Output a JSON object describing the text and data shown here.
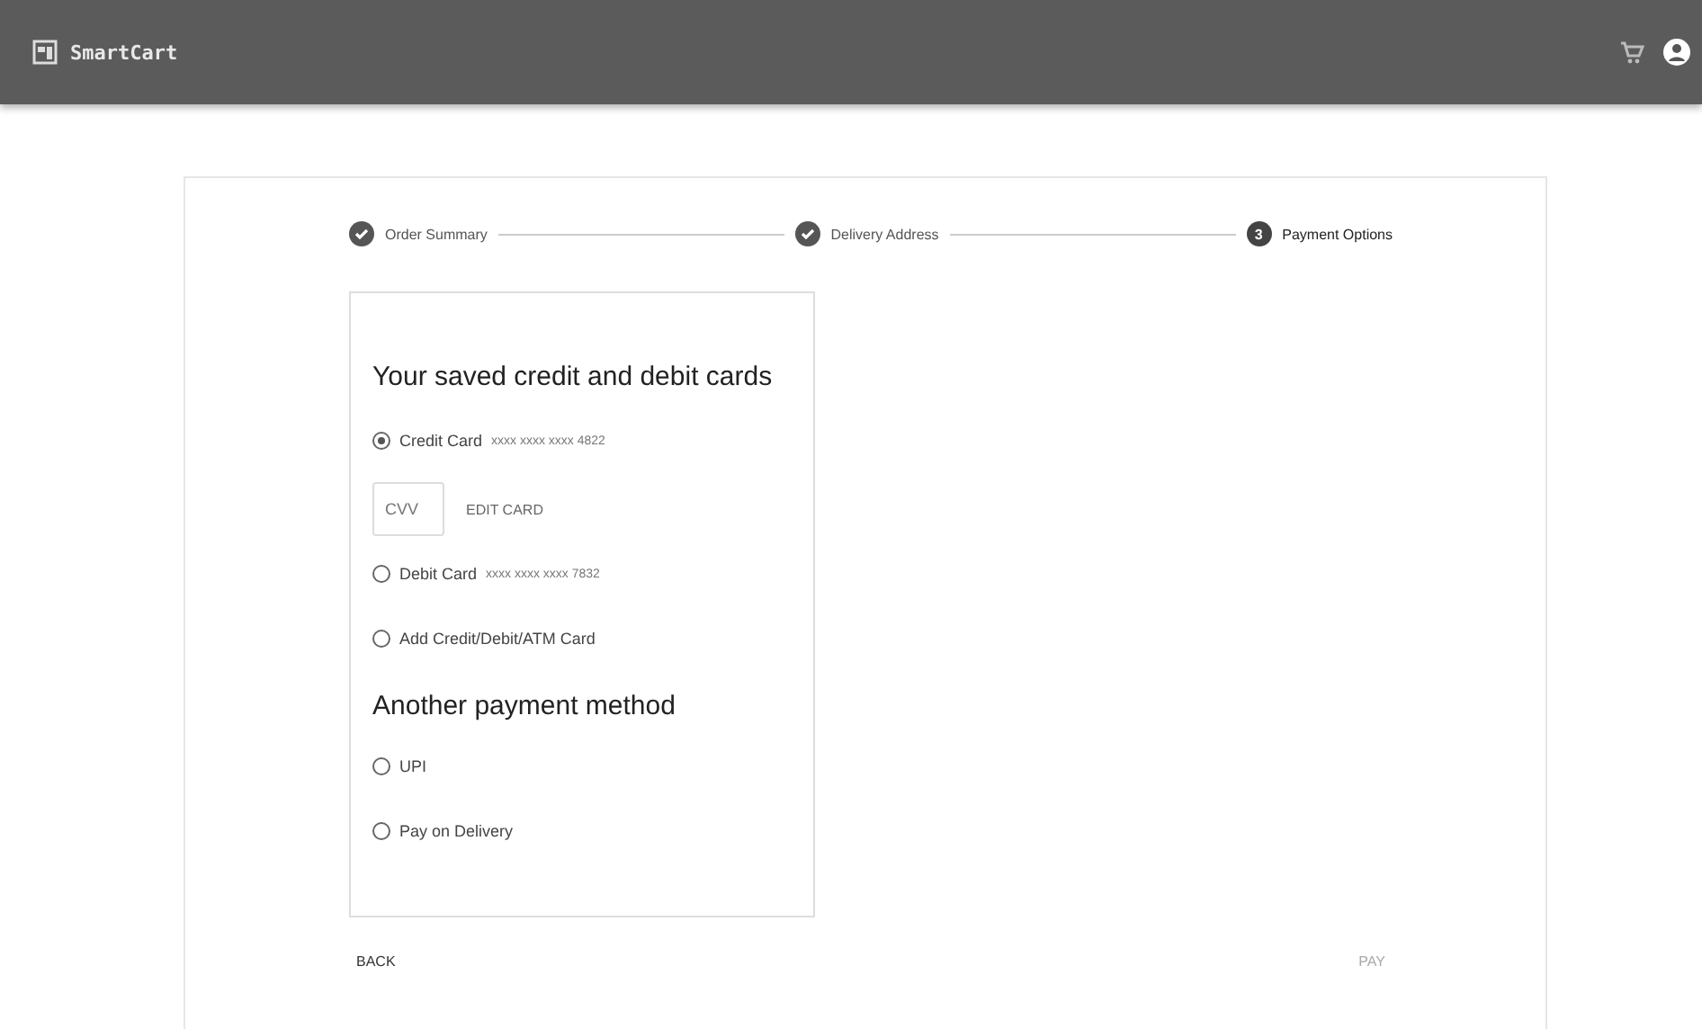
{
  "app": {
    "name": "SmartCart"
  },
  "steps": [
    {
      "label": "Order Summary",
      "completed": true,
      "selected": false
    },
    {
      "label": "Delivery Address",
      "completed": true,
      "selected": false
    },
    {
      "label": "Payment Options",
      "completed": false,
      "selected": true,
      "number": "3"
    }
  ],
  "saved_cards": {
    "heading": "Your saved credit and debit cards",
    "options": [
      {
        "label": "Credit Card",
        "number": "xxxx xxxx xxxx 4822",
        "selected": true,
        "cvv": {
          "placeholder": "CVV"
        },
        "edit_link": "EDIT CARD"
      },
      {
        "label": "Debit Card",
        "number": "xxxx xxxx xxxx 7832",
        "selected": false
      },
      {
        "label": "Add Credit/Debit/ATM Card",
        "selected": false
      }
    ]
  },
  "other_methods": {
    "heading": "Another payment method",
    "options": [
      {
        "label": "UPI",
        "selected": false
      },
      {
        "label": "Pay on Delivery",
        "selected": false
      }
    ]
  },
  "actions": {
    "back": {
      "label": "BACK",
      "disabled": false
    },
    "pay": {
      "label": "PAY",
      "disabled": true
    }
  }
}
